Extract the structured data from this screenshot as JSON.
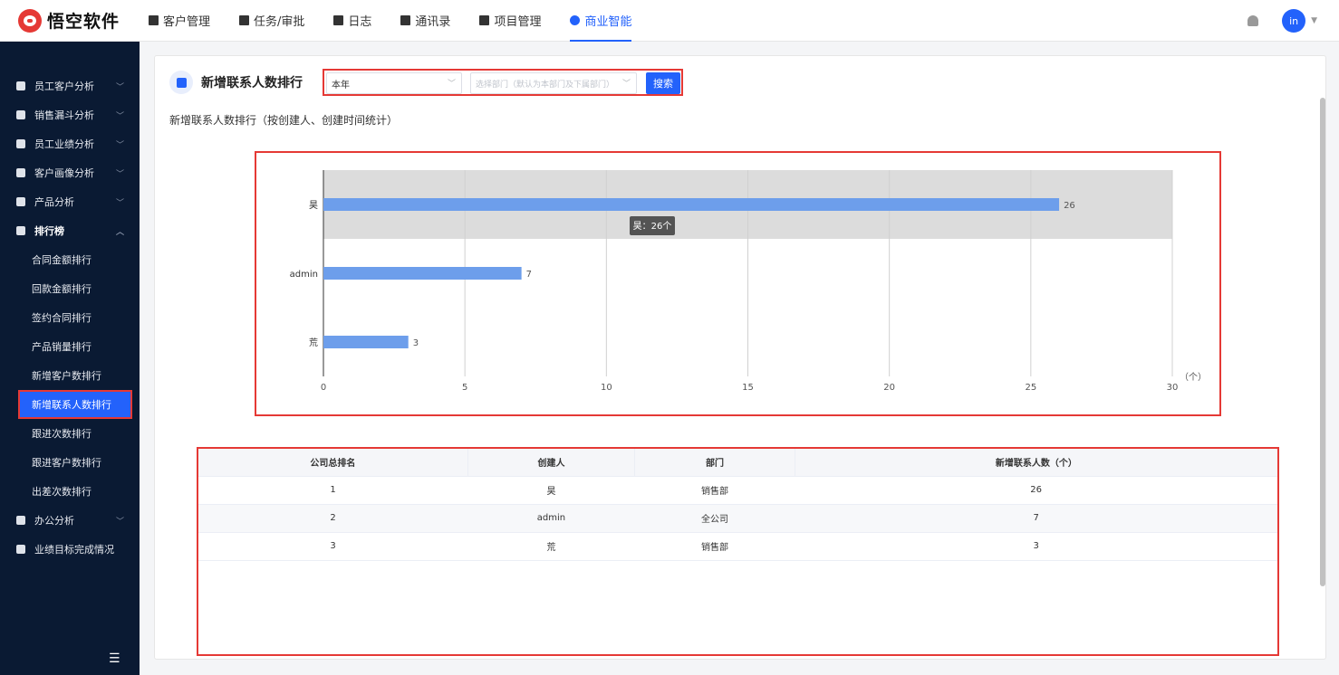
{
  "app": {
    "logo_text": "悟空软件"
  },
  "nav": {
    "items": [
      {
        "label": "客户管理",
        "icon": "building-icon"
      },
      {
        "label": "任务/审批",
        "icon": "briefcase-icon"
      },
      {
        "label": "日志",
        "icon": "log-icon"
      },
      {
        "label": "通讯录",
        "icon": "contacts-icon"
      },
      {
        "label": "项目管理",
        "icon": "project-icon"
      },
      {
        "label": "商业智能",
        "icon": "bi-icon",
        "active": true
      }
    ]
  },
  "user": {
    "avatar_text": "in"
  },
  "sidebar": {
    "groups": [
      {
        "label": "员工客户分析"
      },
      {
        "label": "销售漏斗分析"
      },
      {
        "label": "员工业绩分析"
      },
      {
        "label": "客户画像分析"
      },
      {
        "label": "产品分析"
      },
      {
        "label": "排行榜"
      }
    ],
    "ranking_items": [
      {
        "label": "合同金额排行"
      },
      {
        "label": "回款金额排行"
      },
      {
        "label": "签约合同排行"
      },
      {
        "label": "产品销量排行"
      },
      {
        "label": "新增客户数排行"
      },
      {
        "label": "新增联系人数排行"
      },
      {
        "label": "跟进次数排行"
      },
      {
        "label": "跟进客户数排行"
      },
      {
        "label": "出差次数排行"
      }
    ],
    "bottom_groups": [
      {
        "label": "办公分析"
      },
      {
        "label": "业绩目标完成情况"
      }
    ]
  },
  "page": {
    "title": "新增联系人数排行",
    "subtitle": "新增联系人数排行（按创建人、创建时间统计）",
    "filter": {
      "period_value": "本年",
      "dept_placeholder": "选择部门（默认为本部门及下属部门）",
      "search_label": "搜索"
    }
  },
  "chart_data": {
    "type": "bar",
    "orientation": "horizontal",
    "categories": [
      "昊",
      "admin",
      "荒"
    ],
    "values": [
      26,
      7,
      3
    ],
    "xlim": [
      0,
      30
    ],
    "xticks": [
      "0",
      "5",
      "10",
      "15",
      "20",
      "25",
      "30"
    ],
    "unit_label": "（个）",
    "bar_color": "#6d9eeb",
    "highlight_color": "#dcdcdc",
    "tooltip": "昊：26个",
    "grid": true
  },
  "table": {
    "columns": [
      "公司总排名",
      "创建人",
      "部门",
      "新增联系人数（个）"
    ],
    "rows": [
      [
        "1",
        "昊",
        "销售部",
        "26"
      ],
      [
        "2",
        "admin",
        "全公司",
        "7"
      ],
      [
        "3",
        "荒",
        "销售部",
        "3"
      ]
    ]
  }
}
